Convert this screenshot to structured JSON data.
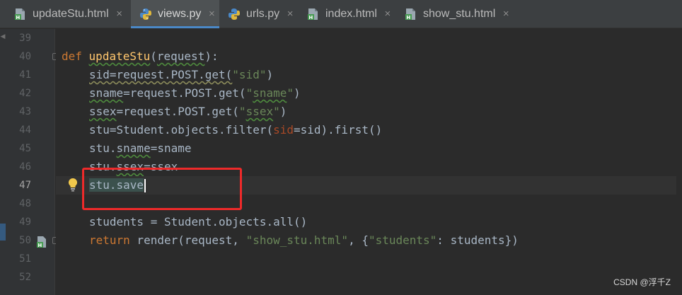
{
  "tabs": [
    {
      "label": "updateStu.html",
      "icon": "html-file-icon",
      "active": false
    },
    {
      "label": "views.py",
      "icon": "python-file-icon",
      "active": true
    },
    {
      "label": "urls.py",
      "icon": "python-file-icon",
      "active": false
    },
    {
      "label": "index.html",
      "icon": "html-file-icon",
      "active": false
    },
    {
      "label": "show_stu.html",
      "icon": "html-file-icon",
      "active": false
    }
  ],
  "tab_close_glyph": "×",
  "line_numbers": [
    "39",
    "40",
    "41",
    "42",
    "43",
    "44",
    "45",
    "46",
    "47",
    "48",
    "49",
    "50",
    "51",
    "52"
  ],
  "current_line": "47",
  "code": {
    "l40": {
      "kw": "def",
      "fn": "updateStu",
      "open": "(",
      "param": "request",
      "close": "):"
    },
    "l41": {
      "a": "sid=request.POST.get(",
      "s": "\"sid\"",
      "b": ")"
    },
    "l42": {
      "a": "sname",
      "b": "=request.POST.get(",
      "s_q1": "\"",
      "s": "sname",
      "s_q2": "\"",
      "c": ")"
    },
    "l43": {
      "a": "ssex",
      "b": "=request.POST.get(",
      "s_q1": "\"",
      "s": "ssex",
      "s_q2": "\"",
      "c": ")"
    },
    "l44": {
      "a": "stu",
      "b": "=Student.objects.filter(",
      "p": "sid",
      "c": "=sid).first()"
    },
    "l45": {
      "a": "stu.",
      "b": "sname",
      "c": "=sname"
    },
    "l46": {
      "a": "stu.",
      "b": "ssex",
      "c": "=ssex"
    },
    "l47": {
      "a": "stu.save"
    },
    "l49": {
      "a": "students = Student.objects.all()"
    },
    "l50": {
      "kw": "return",
      "a": " render(request, ",
      "s1": "\"show_stu.html\"",
      "b": ", {",
      "s2": "\"students\"",
      "c": ": students})"
    }
  },
  "watermark": "CSDN @浮千Z",
  "colors": {
    "keyword": "#cc7832",
    "function": "#ffc66d",
    "string": "#6a8759",
    "text": "#a9b7c6",
    "highlight_box": "#ee2a2a",
    "active_tab_underline": "#4a88c7"
  }
}
